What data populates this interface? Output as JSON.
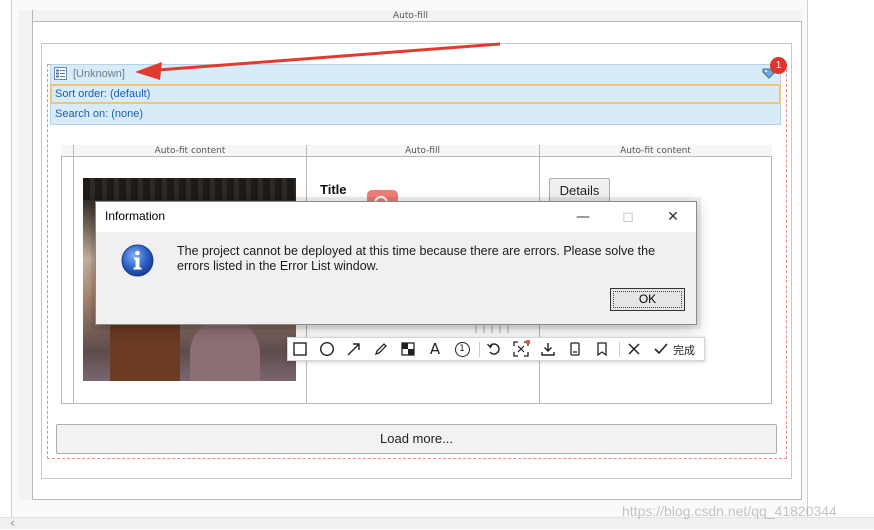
{
  "designer": {
    "autofill_top": "Auto-fill",
    "grid_columns": [
      "Auto-fit content",
      "Auto-fill",
      "Auto-fit content"
    ]
  },
  "list": {
    "header_unknown": "[Unknown]",
    "sort_order": "Sort order: (default)",
    "search_on": "Search on: (none)",
    "badge_count": "1",
    "item_title": "Title",
    "details_label": "Details",
    "load_more": "Load more..."
  },
  "dialog": {
    "title": "Information",
    "message": "The project cannot be deployed at this time because there are errors. Please solve the errors listed in the Error List window.",
    "ok_label": "OK"
  },
  "snip_toolbar": {
    "tools": [
      "rectangle-icon",
      "ellipse-icon",
      "arrow-icon",
      "pen-icon",
      "mosaic-icon",
      "text-icon",
      "number-marker-icon",
      "undo-icon",
      "ocr-icon",
      "download-icon",
      "pin-icon",
      "bookmark-icon",
      "cancel-icon",
      "confirm-icon"
    ],
    "text_tool_label": "A",
    "number_marker_label": "1",
    "done_label": "完成"
  },
  "watermark": "https://blog.csdn.net/qq_41820344"
}
